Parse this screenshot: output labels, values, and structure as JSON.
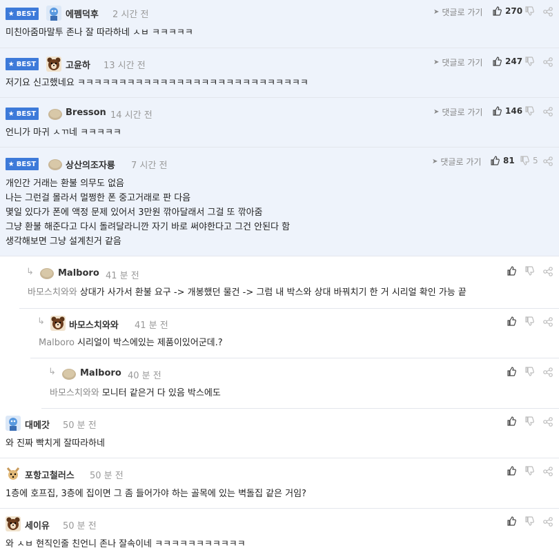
{
  "labels": {
    "best": "BEST",
    "reply_to": "댓글로 가기"
  },
  "colors": {
    "best_badge": "#3d7ad9",
    "best_background": "#eef3fb"
  },
  "best_comments": [
    {
      "avatar": "blue-character",
      "nickname": "에펨덕후",
      "time": "2 시간 전",
      "upvotes": "270",
      "downvotes": "",
      "lines": [
        "미친아줌마말투 존나 잘 따라하네 ㅅㅂ ㅋㅋㅋㅋㅋ"
      ]
    },
    {
      "avatar": "bear-character",
      "nickname": "고윤하",
      "time": "13 시간 전",
      "upvotes": "247",
      "downvotes": "",
      "lines": [
        "저기요 신고했네요 ㅋㅋㅋㅋㅋㅋㅋㅋㅋㅋㅋㅋㅋㅋㅋㅋㅋㅋㅋㅋㅋㅋㅋㅋㅋㅋㅋㅋ"
      ]
    },
    {
      "avatar": "default-potato",
      "nickname": "Bresson",
      "time": "14 시간 전",
      "upvotes": "146",
      "downvotes": "",
      "lines": [
        "언니가 마귀 ㅅㄲ네 ㅋㅋㅋㅋㅋ"
      ]
    },
    {
      "avatar": "default-potato",
      "nickname": "상산의조자룡",
      "time": "7 시간 전",
      "upvotes": "81",
      "downvotes": "5",
      "lines": [
        "개인간 거래는 환불 의무도 없음",
        "나는 그런걸 몰라서 멀쩡한 폰 중고거래로 판 다음",
        "몇일 있다가 폰에 액정 문제 있어서 3만원 깎아달래서 그걸 또 깎아줌",
        "그냥 환불 해준다고 다시 돌려달라니깐 자기 바로 써야한다고 그건 안된다 함",
        "생각해보면 그냥 설계친거 같음"
      ]
    }
  ],
  "replies": [
    {
      "avatar": "default-potato",
      "nickname": "Malboro",
      "time": "41 분 전",
      "mention": "바모스치와와",
      "text": "상대가 사가서 환불 요구 -> 개봉했던 물건 -> 그럼 내 박스와 상대 바꿔치기 한 거 시리얼 확인 가능 끝"
    },
    {
      "avatar": "bear-character",
      "nickname": "바모스치와와",
      "time": "41 분 전",
      "mention": "Malboro",
      "text": "시리얼이 박스에있는 제품이있어군데.?"
    },
    {
      "avatar": "default-potato",
      "nickname": "Malboro",
      "time": "40 분 전",
      "mention": "바모스치와와",
      "text": "모니터 같은거 다 있음 박스에도"
    }
  ],
  "comments": [
    {
      "avatar": "blue-character",
      "nickname": "대메갓",
      "time": "50 분 전",
      "text": "와 진짜 빡치게 잘따라하네"
    },
    {
      "avatar": "dog-character",
      "nickname": "포항고철러스",
      "time": "50 분 전",
      "text": "1층에 호프집, 3층에 집이면 그 좀 들어가야 하는 골목에 있는 벽돌집 같은 거임?"
    },
    {
      "avatar": "bear-character",
      "nickname": "세이유",
      "time": "50 분 전",
      "text": "와 ㅅㅂ 현직인줄 친언니 존나 잘속이네 ㅋㅋㅋㅋㅋㅋㅋㅋㅋㅋㅋ"
    }
  ]
}
